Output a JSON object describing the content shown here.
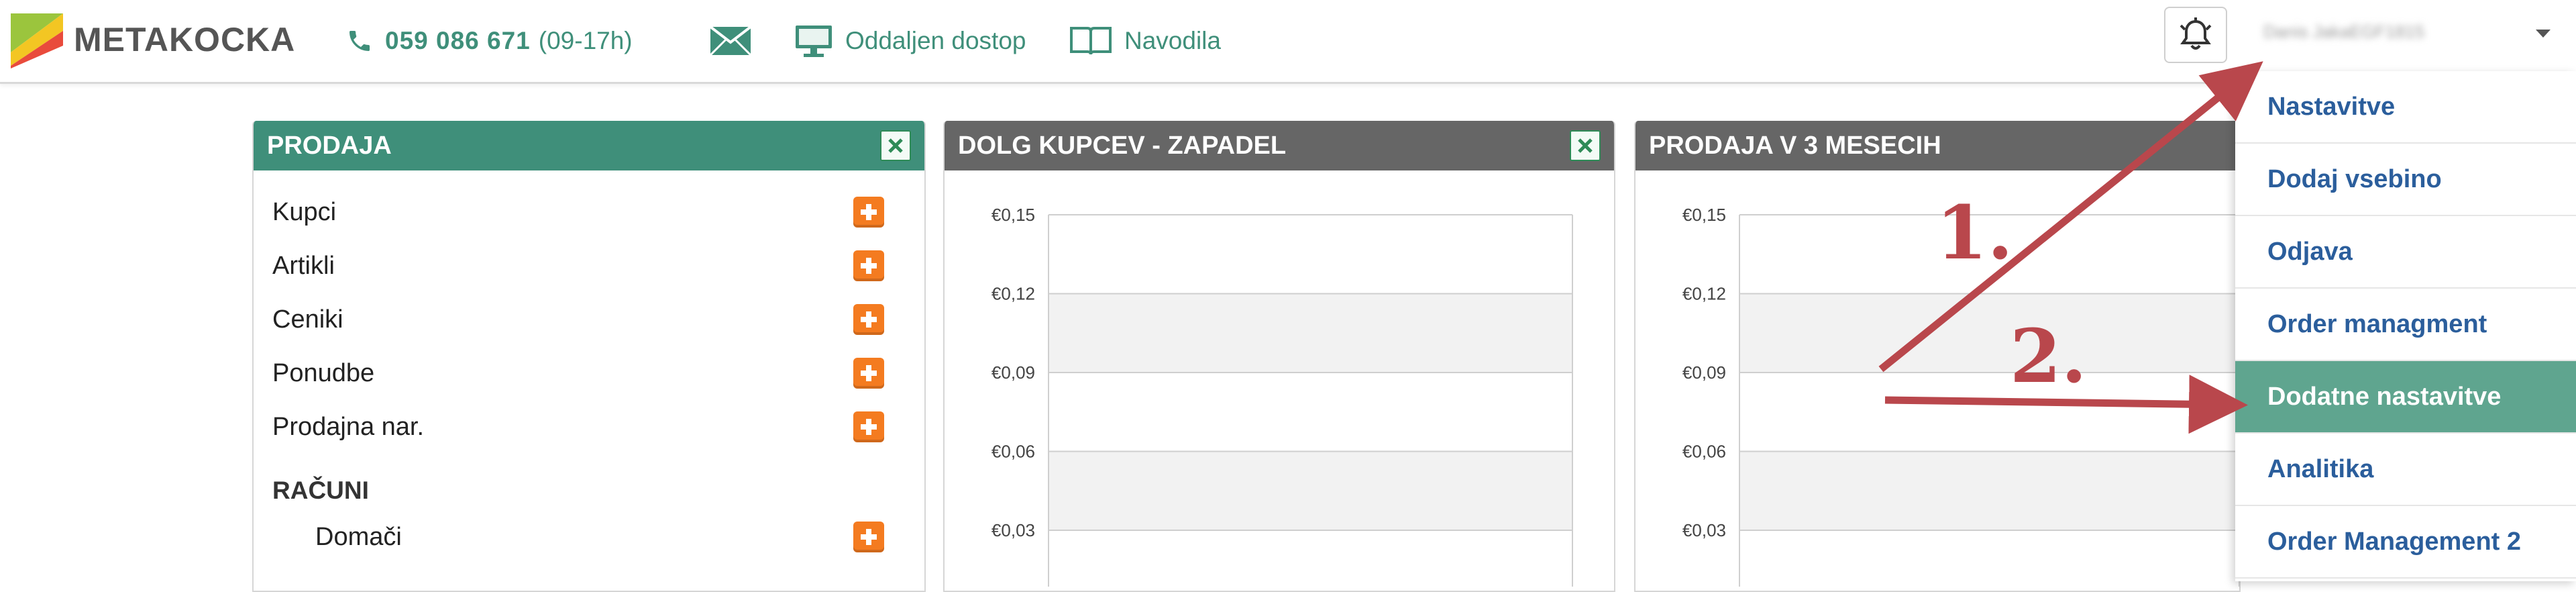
{
  "header": {
    "logo_text": "METAKOCKA",
    "phone_number": "059 086 671",
    "phone_hours": "(09-17h)",
    "remote_access_label": "Oddaljen dostop",
    "instructions_label": "Navodila",
    "user_name": "Danis JakaEGF1815",
    "icons": {
      "phone": "phone-icon",
      "mail": "mail-icon",
      "remote": "monitor-icon",
      "instructions": "book-icon",
      "notifications": "bell-icon"
    }
  },
  "panels": {
    "sales": {
      "title": "PRODAJA",
      "items": [
        "Kupci",
        "Artikli",
        "Ceniki",
        "Ponudbe",
        "Prodajna nar."
      ],
      "section_title": "RAČUNI",
      "section_items": [
        "Domači"
      ]
    },
    "debt": {
      "title": "DOLG KUPCEV - ZAPADEL"
    },
    "sales3m": {
      "title": "PRODAJA V 3 MESECIH"
    }
  },
  "chart_data": [
    {
      "type": "bar",
      "title": "DOLG KUPCEV - ZAPADEL",
      "y_ticks": [
        "€0,15",
        "€0,12",
        "€0,09",
        "€0,06",
        "€0,03"
      ],
      "ylim": [
        0,
        0.15
      ],
      "series": [],
      "grid": true
    },
    {
      "type": "bar",
      "title": "PRODAJA V 3 MESECIH",
      "y_ticks": [
        "€0,15",
        "€0,12",
        "€0,09",
        "€0,06",
        "€0,03"
      ],
      "ylim": [
        0,
        0.15
      ],
      "series": [],
      "grid": true
    }
  ],
  "dropdown": {
    "items": [
      "Nastavitve",
      "Dodaj vsebino",
      "Odjava",
      "Order managment",
      "Dodatne nastavitve",
      "Analitika",
      "Order Management 2"
    ],
    "active_item": "Dodatne nastavitve"
  },
  "annotations": {
    "step1": "1.",
    "step2": "2."
  },
  "colors": {
    "brand_green": "#3f8f7a",
    "panel_green": "#3f8f7a",
    "panel_gray": "#666666",
    "link_blue": "#2b5e9c",
    "active_item": "#5fa58f",
    "annotation_red": "#b9474c",
    "plus_orange": "#f47b20"
  }
}
